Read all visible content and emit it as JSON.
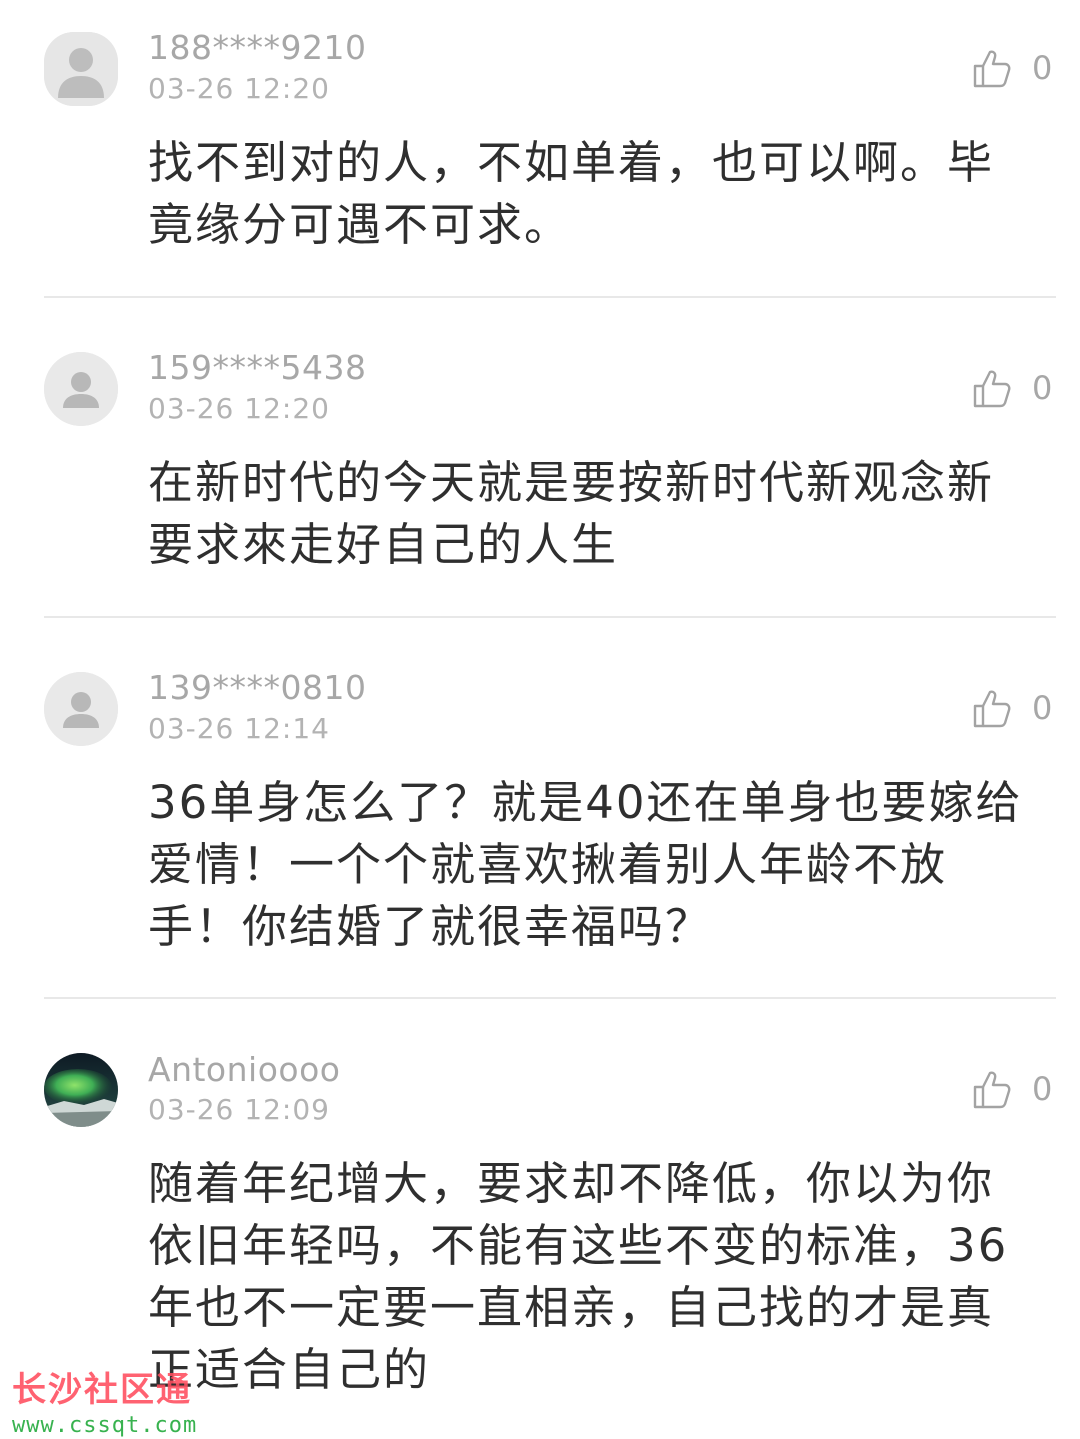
{
  "comments": [
    {
      "username": "188****9210",
      "time": "03-26 12:20",
      "likes": "0",
      "text": "找不到对的人，不如单着，也可以啊。毕竟缘分可遇不可求。",
      "avatar": "default-user-avatar"
    },
    {
      "username": "159****5438",
      "time": "03-26 12:20",
      "likes": "0",
      "text": "在新时代的今天就是要按新时代新观念新要求來走好自己的人生",
      "avatar": "default-user-avatar"
    },
    {
      "username": "139****0810",
      "time": "03-26 12:14",
      "likes": "0",
      "text": "36单身怎么了？就是40还在单身也要嫁给爱情！一个个就喜欢揪着别人年龄不放手！你结婚了就很幸福吗？",
      "avatar": "default-user-avatar"
    },
    {
      "username": "Antonioooo",
      "time": "03-26 12:09",
      "likes": "0",
      "text": "随着年纪增大，要求却不降低，你以为你依旧年轻吗，不能有这些不变的标准，36年也不一定要一直相亲，自己找的才是真正适合自己的",
      "avatar": "aurora-photo-avatar"
    }
  ],
  "watermark": {
    "title": "长沙社区通",
    "url": "www.cssqt.com"
  },
  "colors": {
    "meta_text": "#a7a7a7",
    "body_text": "#2f2f2f",
    "divider": "#e8e8e8",
    "watermark_red": "#ff4d5e",
    "watermark_green": "#38b24f"
  },
  "icons": {
    "like": "thumbs-up-outline-icon"
  }
}
